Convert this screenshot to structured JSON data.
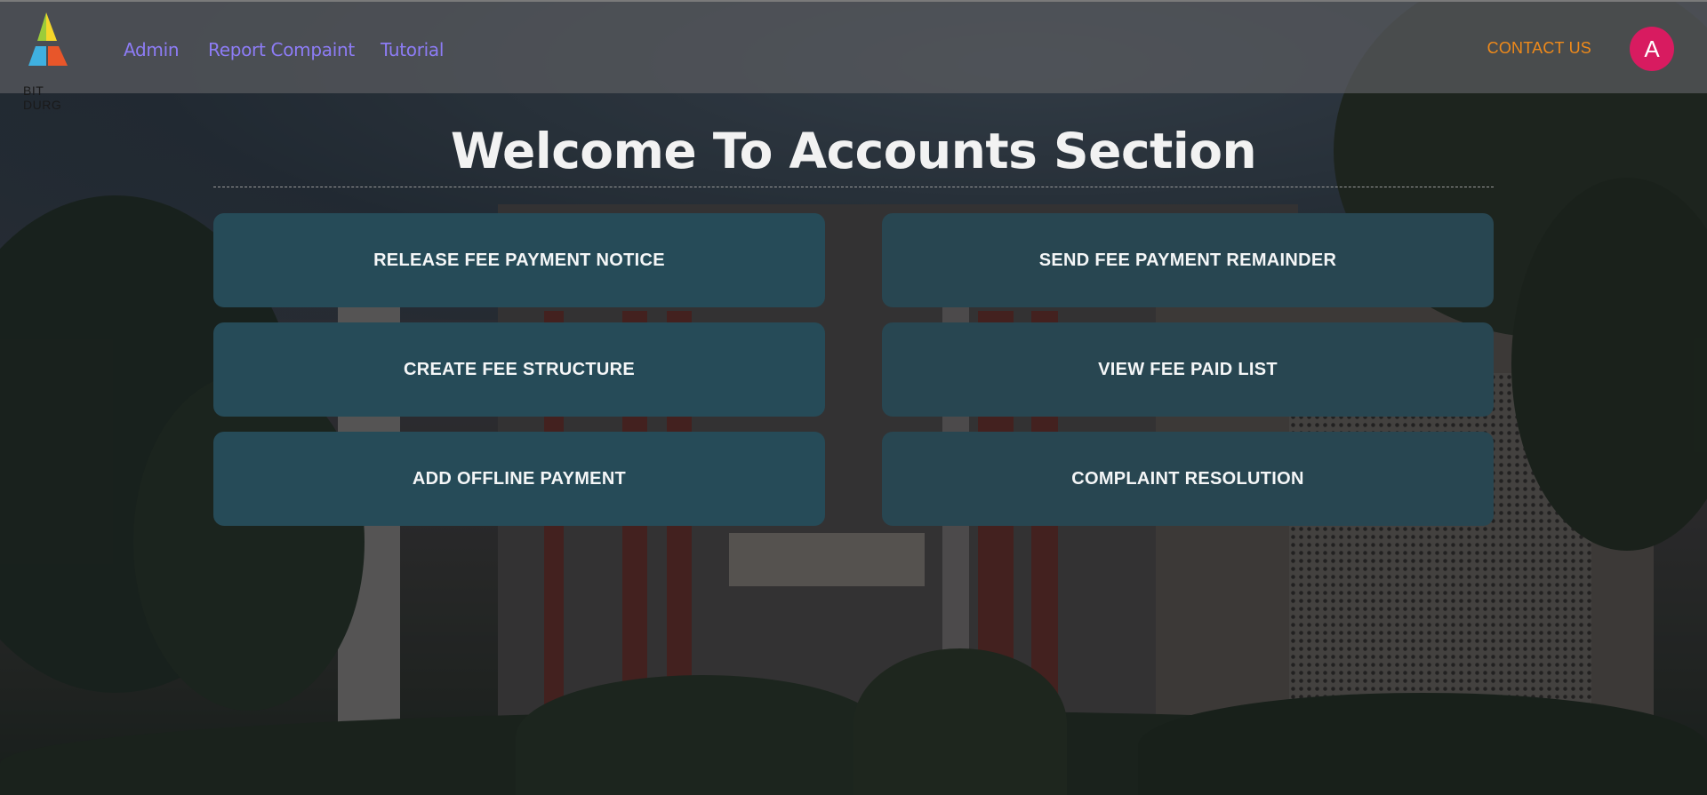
{
  "brand": {
    "logo_text": "BIT DURG",
    "logo_icon": "triangle-logo-icon",
    "colors": {
      "top": "#9ccc3a",
      "right": "#f5d62a",
      "left": "#3fb0e0",
      "bottom": "#e8562a"
    }
  },
  "nav": {
    "links": [
      {
        "label": "Admin"
      },
      {
        "label": "Report Compaint"
      },
      {
        "label": "Tutorial"
      }
    ],
    "contact_label": "CONTACT US",
    "avatar_initial": "A"
  },
  "main": {
    "title": "Welcome To Accounts Section",
    "buttons": [
      {
        "label": "RELEASE FEE PAYMENT NOTICE"
      },
      {
        "label": "SEND FEE PAYMENT REMAINDER"
      },
      {
        "label": "CREATE FEE STRUCTURE"
      },
      {
        "label": "VIEW FEE PAID LIST"
      },
      {
        "label": "ADD OFFLINE PAYMENT"
      },
      {
        "label": "COMPLAINT RESOLUTION"
      }
    ]
  },
  "theme": {
    "accent": "#8d7cf5",
    "contact": "#f08a1a",
    "avatar": "#d81b60",
    "card": "#264b58"
  }
}
